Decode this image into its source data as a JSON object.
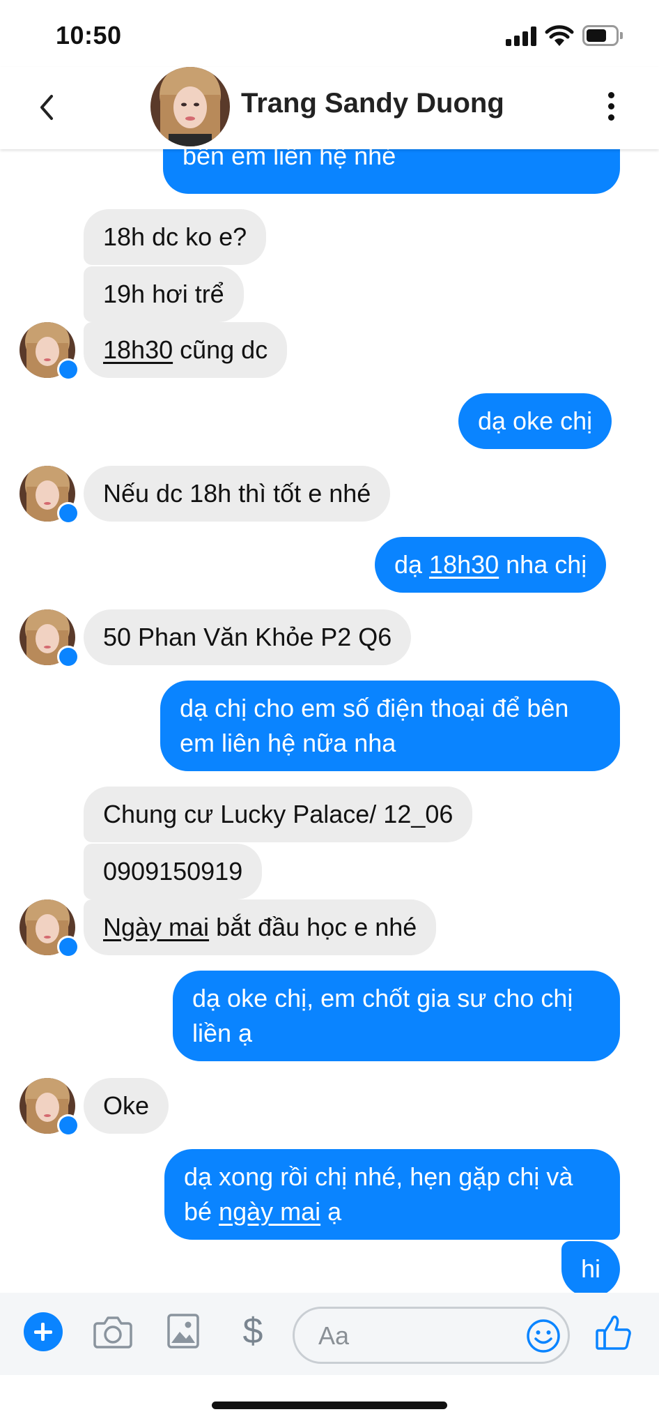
{
  "status_bar": {
    "time": "10:50"
  },
  "header": {
    "contact_name": "Trang Sandy Duong"
  },
  "messages": [
    {
      "dir": "out",
      "lines": [
        "bên em liên hệ nhé"
      ]
    },
    {
      "dir": "in",
      "lines": [
        "18h dc ko e?"
      ]
    },
    {
      "dir": "in",
      "lines": [
        "19h hơi trể"
      ]
    },
    {
      "dir": "in",
      "underline": "18h30",
      "rest": " cũng dc"
    },
    {
      "dir": "out",
      "lines": [
        "dạ oke chị"
      ]
    },
    {
      "dir": "in",
      "lines": [
        "Nếu dc 18h thì tốt e nhé"
      ]
    },
    {
      "dir": "out",
      "pre": "dạ ",
      "underline": "18h30",
      "rest": " nha chị"
    },
    {
      "dir": "in",
      "lines": [
        "50 Phan Văn Khỏe P2 Q6"
      ]
    },
    {
      "dir": "out",
      "lines": [
        "dạ chị cho em số điện thoại để bên",
        "em liên hệ nữa nha"
      ]
    },
    {
      "dir": "in",
      "lines": [
        "Chung cư Lucky Palace/ 12_06"
      ]
    },
    {
      "dir": "in",
      "lines": [
        "0909150919"
      ]
    },
    {
      "dir": "in",
      "underline": "Ngày mai",
      "rest": " bắt đầu học e nhé"
    },
    {
      "dir": "out",
      "lines": [
        "dạ oke chị, em chốt gia sư cho chị",
        "liền ạ"
      ]
    },
    {
      "dir": "in",
      "lines": [
        "Oke"
      ]
    },
    {
      "dir": "out",
      "line1": "dạ xong rồi chị nhé, hẹn gặp chị và",
      "pre2": "bé ",
      "underline": "ngày mai",
      "rest": " ạ"
    },
    {
      "dir": "out",
      "lines": [
        "hi"
      ]
    }
  ],
  "composer": {
    "placeholder": "Aa",
    "dollar": "$"
  },
  "colors": {
    "outgoing_bubble": "#0a84ff",
    "incoming_bubble": "#ececec",
    "accent": "#0a84ff"
  },
  "icons": [
    "back-icon",
    "more-icon",
    "plus-icon",
    "camera-icon",
    "image-icon",
    "dollar-icon",
    "emoji-icon",
    "like-icon",
    "messenger-badge-icon"
  ]
}
